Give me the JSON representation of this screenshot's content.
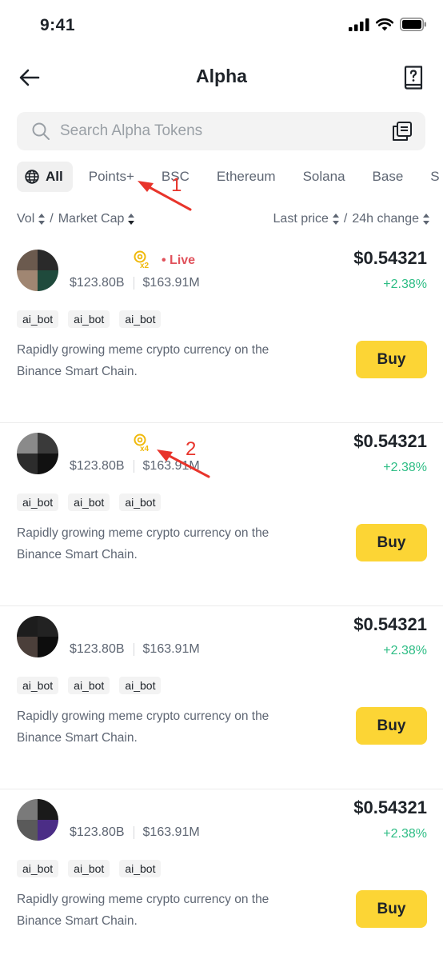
{
  "status_bar": {
    "time": "9:41"
  },
  "header": {
    "title": "Alpha"
  },
  "search": {
    "placeholder": "Search Alpha Tokens"
  },
  "tabs": [
    {
      "label": "All",
      "active": true
    },
    {
      "label": "Points+"
    },
    {
      "label": "BSC"
    },
    {
      "label": "Ethereum"
    },
    {
      "label": "Solana"
    },
    {
      "label": "Base"
    },
    {
      "label": "S"
    }
  ],
  "sort": {
    "left": [
      "Vol",
      "/",
      "Market Cap"
    ],
    "right": [
      "Last price",
      "/",
      "24h change"
    ]
  },
  "tokens": [
    {
      "badge_multiplier": "x2",
      "live": "• Live",
      "vol": "$123.80B",
      "market_cap": "$163.91M",
      "price": "$0.54321",
      "change": "+2.38%",
      "tags": [
        "ai_bot",
        "ai_bot",
        "ai_bot"
      ],
      "description": "Rapidly growing meme crypto currency on the Binance Smart Chain.",
      "buy_label": "Buy",
      "avatar_colors": [
        "#6b5a4e",
        "#2a2a2a",
        "#a08672",
        "#1f4a3c"
      ]
    },
    {
      "badge_multiplier": "x4",
      "live": "",
      "vol": "$123.80B",
      "market_cap": "$163.91M",
      "price": "$0.54321",
      "change": "+2.38%",
      "tags": [
        "ai_bot",
        "ai_bot",
        "ai_bot"
      ],
      "description": "Rapidly growing meme crypto currency on the Binance Smart Chain.",
      "buy_label": "Buy",
      "avatar_colors": [
        "#8a8a8a",
        "#3a3a3a",
        "#2c2c2c",
        "#111111"
      ]
    },
    {
      "badge_multiplier": "",
      "live": "",
      "vol": "$123.80B",
      "market_cap": "$163.91M",
      "price": "$0.54321",
      "change": "+2.38%",
      "tags": [
        "ai_bot",
        "ai_bot",
        "ai_bot"
      ],
      "description": "Rapidly growing meme crypto currency on the Binance Smart Chain.",
      "buy_label": "Buy",
      "avatar_colors": [
        "#1d1d1d",
        "#222222",
        "#4b3f3a",
        "#0d0d0d"
      ]
    },
    {
      "badge_multiplier": "",
      "live": "",
      "vol": "$123.80B",
      "market_cap": "$163.91M",
      "price": "$0.54321",
      "change": "+2.38%",
      "tags": [
        "ai_bot",
        "ai_bot",
        "ai_bot"
      ],
      "description": "Rapidly growing meme crypto currency on the Binance Smart Chain.",
      "buy_label": "Buy",
      "avatar_colors": [
        "#7a7a7a",
        "#1a1a1a",
        "#5a5a5a",
        "#4b2d86"
      ]
    }
  ],
  "annotations": [
    {
      "label": "1",
      "target": "tab-points-plus"
    },
    {
      "label": "2",
      "target": "points-badge-x4"
    }
  ],
  "colors": {
    "accent": "#fcd535",
    "positive": "#2ebd85",
    "live": "#e0515b",
    "annotation": "#e8342b",
    "badge": "#f0b90b"
  },
  "icons": [
    "back-arrow-icon",
    "help-book-icon",
    "search-icon",
    "copy-icon",
    "globe-icon",
    "sort-caret-icon",
    "points-badge-icon"
  ]
}
